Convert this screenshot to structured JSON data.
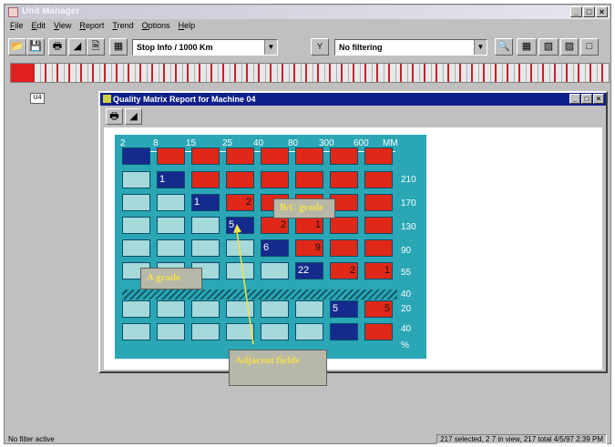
{
  "app": {
    "title": "Unit Manager",
    "window_buttons": [
      "_",
      "□",
      "×"
    ]
  },
  "menu": [
    "File",
    "Edit",
    "View",
    "Report",
    "Trend",
    "Options",
    "Help"
  ],
  "toolbar": {
    "view_combo": "Stop Info / 1000 Km",
    "filter_combo": "No filtering"
  },
  "workspace": {
    "unit_label": "U4"
  },
  "report_window": {
    "title": "Quality Matrix Report for Machine 04",
    "x_axis_ticks": [
      "2",
      "8",
      "15",
      "25",
      "40",
      "80",
      "300",
      "600"
    ],
    "x_axis_unit": "MM",
    "y_axis_ticks": [
      "210",
      "170",
      "130",
      "90",
      "55",
      "40",
      "20",
      "40"
    ],
    "y_axis_unit": "%",
    "rows": [
      [
        {
          "c": "b",
          "v": ""
        },
        {
          "c": "r",
          "v": ""
        },
        {
          "c": "r",
          "v": ""
        },
        {
          "c": "r",
          "v": ""
        },
        {
          "c": "r",
          "v": ""
        },
        {
          "c": "r",
          "v": ""
        },
        {
          "c": "r",
          "v": ""
        },
        {
          "c": "r",
          "v": ""
        }
      ],
      [
        {
          "c": "t",
          "v": ""
        },
        {
          "c": "b",
          "v": "1"
        },
        {
          "c": "r",
          "v": ""
        },
        {
          "c": "r",
          "v": ""
        },
        {
          "c": "r",
          "v": ""
        },
        {
          "c": "r",
          "v": ""
        },
        {
          "c": "r",
          "v": ""
        },
        {
          "c": "r",
          "v": ""
        }
      ],
      [
        {
          "c": "t",
          "v": ""
        },
        {
          "c": "t",
          "v": ""
        },
        {
          "c": "b",
          "v": "1"
        },
        {
          "c": "r",
          "v": "2"
        },
        {
          "c": "r",
          "v": ""
        },
        {
          "c": "r",
          "v": ""
        },
        {
          "c": "r",
          "v": ""
        },
        {
          "c": "r",
          "v": ""
        }
      ],
      [
        {
          "c": "t",
          "v": ""
        },
        {
          "c": "t",
          "v": ""
        },
        {
          "c": "t",
          "v": ""
        },
        {
          "c": "b",
          "v": "5"
        },
        {
          "c": "r",
          "v": "2"
        },
        {
          "c": "r",
          "v": "1"
        },
        {
          "c": "r",
          "v": ""
        },
        {
          "c": "r",
          "v": ""
        }
      ],
      [
        {
          "c": "t",
          "v": ""
        },
        {
          "c": "t",
          "v": ""
        },
        {
          "c": "t",
          "v": ""
        },
        {
          "c": "t",
          "v": ""
        },
        {
          "c": "b",
          "v": "6"
        },
        {
          "c": "r",
          "v": "9"
        },
        {
          "c": "r",
          "v": ""
        },
        {
          "c": "r",
          "v": ""
        }
      ],
      [
        {
          "c": "t",
          "v": ""
        },
        {
          "c": "t",
          "v": ""
        },
        {
          "c": "t",
          "v": ""
        },
        {
          "c": "t",
          "v": ""
        },
        {
          "c": "t",
          "v": ""
        },
        {
          "c": "b",
          "v": "22"
        },
        {
          "c": "r",
          "v": "2"
        },
        {
          "c": "r",
          "v": "1"
        }
      ],
      [
        {
          "c": "t",
          "v": ""
        },
        {
          "c": "t",
          "v": ""
        },
        {
          "c": "t",
          "v": ""
        },
        {
          "c": "t",
          "v": ""
        },
        {
          "c": "t",
          "v": ""
        },
        {
          "c": "t",
          "v": ""
        },
        {
          "c": "b",
          "v": "5"
        },
        {
          "c": "r",
          "v": "5"
        }
      ],
      [
        {
          "c": "t",
          "v": ""
        },
        {
          "c": "t",
          "v": ""
        },
        {
          "c": "t",
          "v": ""
        },
        {
          "c": "t",
          "v": ""
        },
        {
          "c": "t",
          "v": ""
        },
        {
          "c": "t",
          "v": ""
        },
        {
          "c": "b",
          "v": ""
        },
        {
          "c": "r",
          "v": ""
        }
      ]
    ],
    "callouts": {
      "bc_grade": "B/C grade",
      "a_grade": "A grade",
      "adjacent": "Adjacent fields"
    }
  },
  "colors": {
    "matrix_bg": "#2aa6b4",
    "reject": "#e02818",
    "on_target": "#142a8c",
    "good": "#a6dada",
    "title_blue": "#10208a"
  },
  "status": {
    "left": "No filter active",
    "right": "217 selected, 2 7 in view, 217 total  4/5/97 2:39 PM"
  }
}
